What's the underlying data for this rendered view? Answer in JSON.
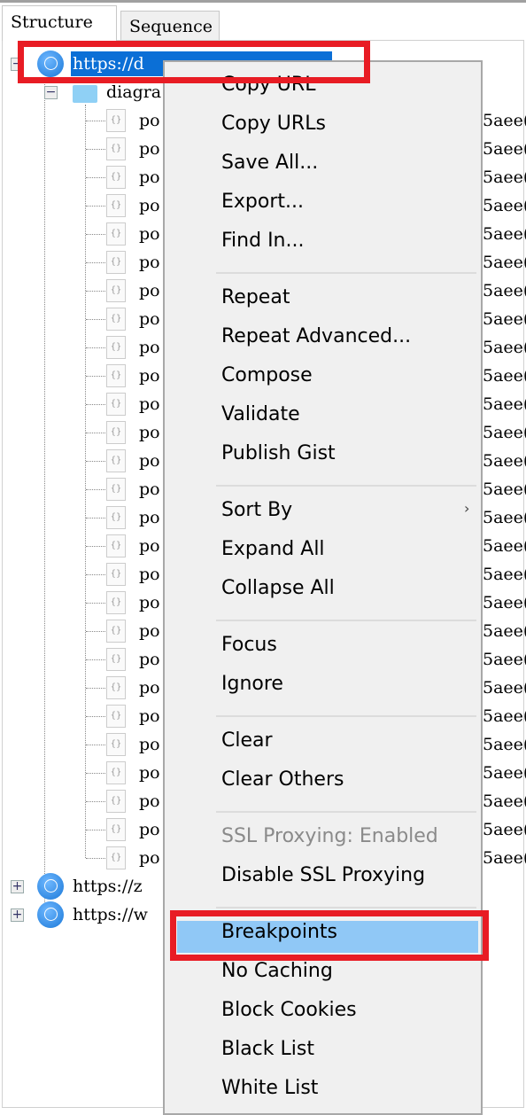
{
  "tabs": [
    {
      "label": "Structure",
      "active": true
    },
    {
      "label": "Sequence",
      "active": false
    }
  ],
  "tree": {
    "hosts": [
      {
        "label": "https://d",
        "expanded": true
      },
      {
        "label": "https://z",
        "expanded": false
      },
      {
        "label": "https://w",
        "expanded": false
      }
    ],
    "folder": {
      "label": "diagra"
    },
    "file_label": "po",
    "file_count": 27,
    "right_fragment": "5aee("
  },
  "context_menu": {
    "items": [
      {
        "label": "Copy URL"
      },
      {
        "label": "Copy URLs"
      },
      {
        "label": "Save All..."
      },
      {
        "label": "Export..."
      },
      {
        "label": "Find In..."
      },
      {
        "sep": true
      },
      {
        "label": "Repeat"
      },
      {
        "label": "Repeat Advanced..."
      },
      {
        "label": "Compose"
      },
      {
        "label": "Validate"
      },
      {
        "label": "Publish Gist"
      },
      {
        "sep": true
      },
      {
        "label": "Sort By",
        "submenu": true
      },
      {
        "label": "Expand All"
      },
      {
        "label": "Collapse All"
      },
      {
        "sep": true
      },
      {
        "label": "Focus"
      },
      {
        "label": "Ignore"
      },
      {
        "sep": true
      },
      {
        "label": "Clear"
      },
      {
        "label": "Clear Others"
      },
      {
        "sep": true
      },
      {
        "label": "SSL Proxying: Enabled",
        "disabled": true
      },
      {
        "label": "Disable SSL Proxying"
      },
      {
        "sep": true
      },
      {
        "label": "Breakpoints",
        "highlighted": true
      },
      {
        "label": "No Caching"
      },
      {
        "label": "Block Cookies"
      },
      {
        "label": "Black List"
      },
      {
        "label": "White List"
      }
    ]
  },
  "colors": {
    "selection": "#0b6fd6",
    "menu_highlight": "#90c8f6",
    "annotation": "#e81c24"
  }
}
